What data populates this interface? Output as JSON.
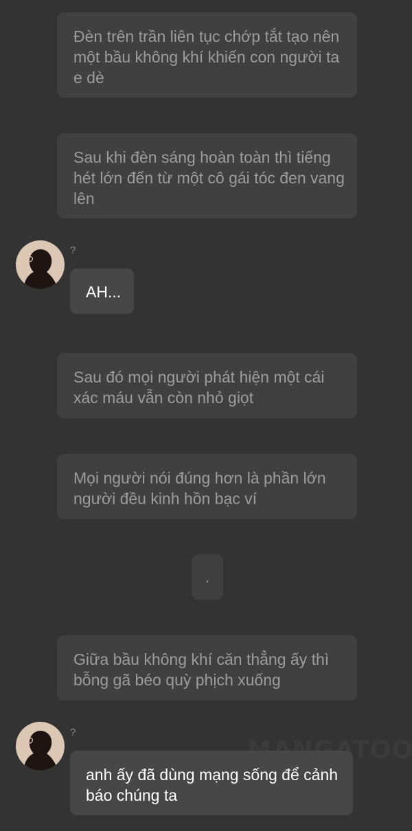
{
  "messages": [
    {
      "type": "narration",
      "text": "Đèn trên trần liên tục chớp tắt tạo nên một bầu không khí khiến con người ta e dè"
    },
    {
      "type": "narration",
      "text": "Sau khi đèn sáng hoàn toàn thì tiếng hét lớn đến từ một cô gái tóc đen vang lên"
    },
    {
      "type": "speech",
      "speaker": "?",
      "avatar_icon": "silhouette-avatar-icon",
      "text": "AH..."
    },
    {
      "type": "narration",
      "text": "Sau đó mọi người phát hiện một cái xác máu vẫn còn nhỏ giọt"
    },
    {
      "type": "narration",
      "text": "Mọi người nói đúng hơn là phần lớn người đều kinh hồn bạc ví"
    },
    {
      "type": "narration",
      "text": "."
    },
    {
      "type": "narration",
      "text": "Giữa bầu không khí căn thẳng ấy thì bỗng gã béo quỳ phịch xuống"
    },
    {
      "type": "speech",
      "speaker": "?",
      "avatar_icon": "silhouette-avatar-icon",
      "text": "anh ấy đã dùng mạng sống để cảnh báo chúng ta"
    }
  ],
  "watermark": "MANGATOON",
  "colors": {
    "background": "#333333",
    "narration_bubble": "#404040",
    "narration_text": "#9c9c9c",
    "speech_bubble": "#474747",
    "speech_text": "#ffffff",
    "avatar_bg": "#dcc7b4",
    "avatar_silhouette": "#1e1512"
  }
}
